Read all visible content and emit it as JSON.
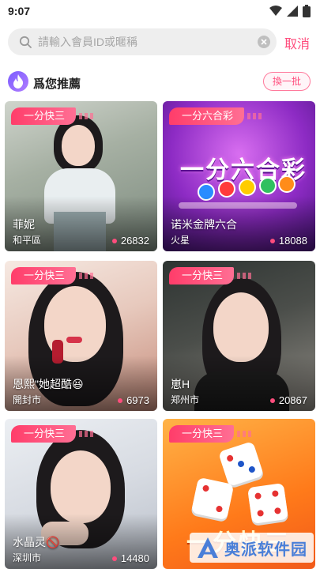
{
  "status_bar": {
    "time": "9:07"
  },
  "search": {
    "placeholder": "請輸入會員ID或暱稱",
    "cancel_label": "取消"
  },
  "section": {
    "title": "爲您推薦",
    "refresh_label": "換一批"
  },
  "cards": [
    {
      "tag": "一分快三",
      "name": "菲妮",
      "city": "和平區",
      "viewers": "26832"
    },
    {
      "tag": "一分六合彩",
      "name": "诺米金牌六合",
      "city": "火星",
      "viewers": "18088",
      "banner": "一分六合彩"
    },
    {
      "tag": "一分快三",
      "name": "恩熙\"她超酷😆",
      "city": "開封市",
      "viewers": "6973"
    },
    {
      "tag": "一分快三",
      "name": "崽H",
      "city": "郑州市",
      "viewers": "20867"
    },
    {
      "tag": "一分快三",
      "name": "水晶灵🚫",
      "city": "深圳市",
      "viewers": "14480"
    },
    {
      "tag": "一分快三",
      "name": "",
      "city": "",
      "viewers": "",
      "banner": "一分快三"
    }
  ],
  "watermark": {
    "text": "奥派软件园"
  },
  "colors": {
    "accent": "#ff4d7d",
    "tag": "#ff3d6a",
    "search_bg": "#eeeeee"
  }
}
